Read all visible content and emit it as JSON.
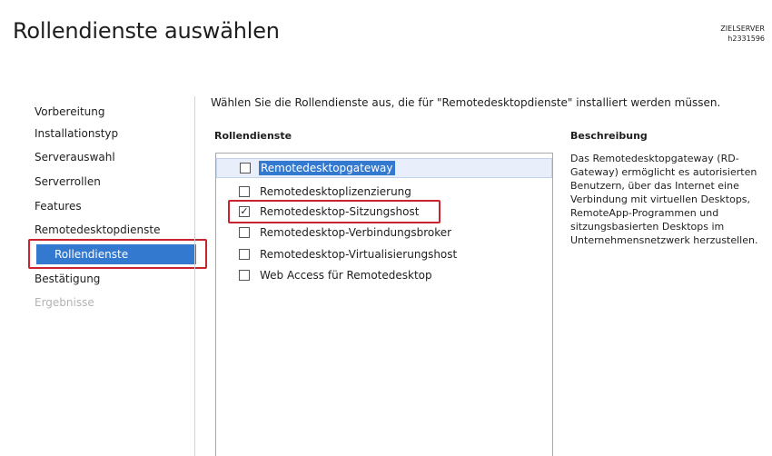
{
  "header": {
    "title": "Rollendienste auswählen",
    "server_label": "ZIELSERVER",
    "server_name": "h2331596"
  },
  "nav": {
    "items": [
      {
        "label": "Vorbereitung",
        "state": "normal"
      },
      {
        "label": "Installationstyp",
        "state": "normal"
      },
      {
        "label": "Serverauswahl",
        "state": "normal"
      },
      {
        "label": "Serverrollen",
        "state": "normal"
      },
      {
        "label": "Features",
        "state": "normal"
      },
      {
        "label": "Remotedesktopdienste",
        "state": "normal"
      },
      {
        "label": "Rollendienste",
        "state": "active"
      },
      {
        "label": "Bestätigung",
        "state": "normal"
      },
      {
        "label": "Ergebnisse",
        "state": "disabled"
      }
    ]
  },
  "main": {
    "instruction": "Wählen Sie die Rollendienste aus, die für \"Remotedesktopdienste\" installiert werden müssen.",
    "list_header": "Rollendienste",
    "roles": [
      {
        "label": "Remotedesktopgateway",
        "checked": false,
        "selected": true
      },
      {
        "label": "Remotedesktoplizenzierung",
        "checked": false,
        "selected": false
      },
      {
        "label": "Remotedesktop-Sitzungshost",
        "checked": true,
        "selected": false
      },
      {
        "label": "Remotedesktop-Verbindungsbroker",
        "checked": false,
        "selected": false
      },
      {
        "label": "Remotedesktop-Virtualisierungshost",
        "checked": false,
        "selected": false
      },
      {
        "label": "Web Access für Remotedesktop",
        "checked": false,
        "selected": false
      }
    ],
    "description_header": "Beschreibung",
    "description": "Das Remotedesktopgateway (RD-Gateway) ermöglicht es autorisierten Benutzern, über das Internet eine Verbindung mit virtuellen Desktops, RemoteApp-Programmen und sitzungsbasierten Desktops im Unternehmensnetzwerk herzustellen."
  },
  "colors": {
    "accent": "#3379cf",
    "highlight_box": "#c8232e",
    "disabled_text": "#b3b3b3"
  }
}
